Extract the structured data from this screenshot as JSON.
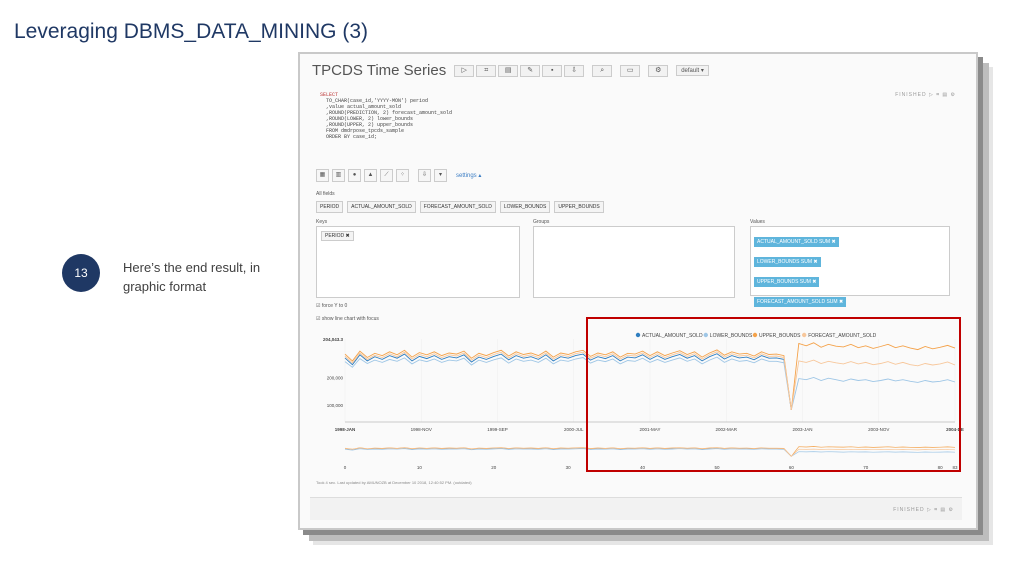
{
  "slide": {
    "title": "Leveraging DBMS_DATA_MINING (3)",
    "step_number": "13",
    "step_text": "Here’s the end result, in graphic format"
  },
  "notebook": {
    "title": "TPCDS Time Series",
    "default_label": "default ▾",
    "finished_label": "FINISHED ▷ ⌗ ▤ ⚙",
    "code_lines": [
      "SELECT",
      "  TO_CHAR(case_id,'YYYY-MON') period",
      "  ,value actual_amount_sold",
      "  ,ROUND(PREDICTION, 2) forecast_amount_sold",
      "  ,ROUND(LOWER, 2) lower_bounds",
      "  ,ROUND(UPPER, 2) upper_bounds",
      "  FROM dmdrpose_tpcds_sample",
      "  ORDER BY case_id;"
    ],
    "settings_label": "settings ▴",
    "all_fields_label": "All fields",
    "fields": [
      "PERIOD",
      "ACTUAL_AMOUNT_SOLD",
      "FORECAST_AMOUNT_SOLD",
      "LOWER_BOUNDS",
      "UPPER_BOUNDS"
    ],
    "keys_label": "Keys",
    "groups_label": "Groups",
    "values_label": "Values",
    "key_chip": "PERIOD ✖",
    "value_chips": [
      "ACTUAL_AMOUNT_SOLD SUM ✖",
      "LOWER_BOUNDS SUM ✖",
      "UPPER_BOUNDS SUM ✖",
      "FORECAST_AMOUNT_SOLD SUM ✖"
    ],
    "force_y_label": "force Y to 0",
    "show_focus_label": "show line chart with focus",
    "footer_text": "Took 4 sec. Last updated by AMUNOZB at December 10 2018, 12:40:52 PM. (outdated)"
  },
  "chart_data": {
    "type": "line",
    "series": [
      {
        "name": "ACTUAL_AMOUNT_SOLD",
        "color": "#2f7ec0",
        "values": [
          230,
          212,
          238,
          222,
          233,
          226,
          236,
          229,
          240,
          222,
          234,
          228,
          236,
          226,
          233,
          230,
          238,
          219,
          232,
          226,
          234,
          240,
          225,
          236,
          229,
          233,
          226,
          238,
          222,
          233,
          229,
          236,
          240,
          224,
          233,
          228,
          236,
          222,
          232,
          230,
          238,
          226,
          236,
          226,
          233,
          239,
          229,
          236,
          222,
          233,
          241,
          227,
          236,
          230,
          232,
          225,
          236,
          229,
          230,
          226,
          92
        ]
      },
      {
        "name": "LOWER_BOUNDS",
        "color": "#9ec6e6",
        "values": [
          220,
          205,
          228,
          215,
          224,
          218,
          226,
          221,
          230,
          214,
          225,
          220,
          227,
          218,
          224,
          222,
          229,
          211,
          224,
          218,
          225,
          230,
          216,
          227,
          221,
          224,
          218,
          229,
          214,
          224,
          221,
          227,
          231,
          216,
          224,
          220,
          227,
          214,
          223,
          221,
          229,
          218,
          226,
          218,
          224,
          230,
          221,
          227,
          214,
          224,
          232,
          218,
          227,
          221,
          223,
          217,
          227,
          221,
          221,
          217,
          92,
          175,
          172,
          178,
          170,
          176,
          172,
          168,
          174,
          170,
          172,
          167,
          170,
          174,
          169,
          172,
          168,
          165,
          170,
          166,
          168,
          172,
          166
        ]
      },
      {
        "name": "UPPER_BOUNDS",
        "color": "#f4a24a",
        "values": [
          240,
          222,
          248,
          231,
          242,
          236,
          246,
          238,
          250,
          232,
          244,
          238,
          246,
          236,
          243,
          240,
          248,
          229,
          242,
          236,
          244,
          250,
          235,
          246,
          239,
          243,
          236,
          248,
          232,
          243,
          239,
          246,
          250,
          234,
          243,
          238,
          246,
          232,
          242,
          240,
          248,
          236,
          246,
          236,
          243,
          249,
          239,
          246,
          232,
          243,
          251,
          237,
          246,
          240,
          242,
          235,
          246,
          239,
          240,
          236,
          92,
          268,
          262,
          270,
          258,
          266,
          261,
          259,
          266,
          257,
          262,
          255,
          260,
          266,
          257,
          262,
          256,
          252,
          260,
          254,
          258,
          263,
          256
        ]
      },
      {
        "name": "FORECAST_AMOUNT_SOLD",
        "color": "#f7c79b",
        "values": [
          235,
          217,
          243,
          226,
          237,
          231,
          241,
          233,
          245,
          227,
          239,
          233,
          241,
          231,
          238,
          235,
          243,
          224,
          237,
          231,
          239,
          245,
          230,
          241,
          234,
          238,
          231,
          243,
          227,
          238,
          234,
          241,
          245,
          229,
          238,
          233,
          241,
          227,
          237,
          235,
          243,
          231,
          241,
          231,
          238,
          244,
          234,
          241,
          227,
          238,
          246,
          232,
          241,
          235,
          237,
          230,
          241,
          234,
          235,
          231,
          92,
          222,
          218,
          224,
          215,
          221,
          217,
          214,
          220,
          214,
          218,
          212,
          215,
          220,
          213,
          218,
          212,
          209,
          215,
          211,
          214,
          219,
          211
        ]
      }
    ],
    "x_tick_labels": [
      "1998-JAN",
      "1998-NOV",
      "1999-SEP",
      "2000-JUL",
      "2001-MAY",
      "2002-MAR",
      "2003-JAN",
      "2003-NOV",
      "2004-DE"
    ],
    "y_tick_labels": [
      "204,043.3",
      "200,000",
      "100,000"
    ],
    "focus_tick_labels": [
      "0",
      "10",
      "20",
      "30",
      "40",
      "50",
      "60",
      "70",
      "80",
      "83"
    ],
    "legend_position": "top-right"
  }
}
